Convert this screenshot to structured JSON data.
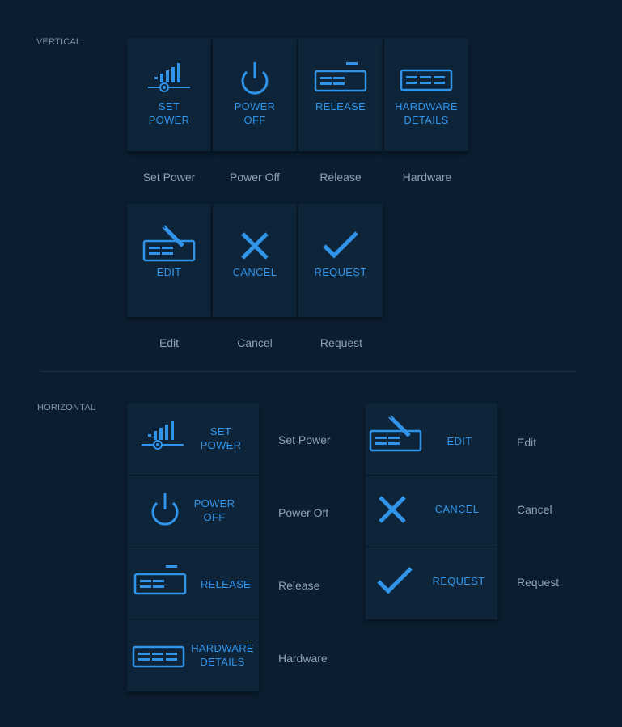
{
  "sections": {
    "vertical_label": "VERTICAL",
    "horizontal_label": "HORIZONTAL"
  },
  "colors": {
    "accent": "#2f94ea",
    "background": "#0b1e30",
    "tile": "#0e2438",
    "caption": "#8ea1b3"
  },
  "buttons": {
    "set_power": {
      "label": "SET\nPOWER",
      "caption": "Set Power",
      "icon": "signal-power-icon"
    },
    "power_off": {
      "label": "POWER\nOFF",
      "caption": "Power Off",
      "icon": "power-icon"
    },
    "release": {
      "label": "RELEASE",
      "caption": "Release",
      "icon": "release-icon"
    },
    "hardware": {
      "label": "HARDWARE\nDETAILS",
      "caption": "Hardware",
      "icon": "hardware-icon"
    },
    "edit": {
      "label": "EDIT",
      "caption": "Edit",
      "icon": "edit-icon"
    },
    "cancel": {
      "label": "CANCEL",
      "caption": "Cancel",
      "icon": "close-icon"
    },
    "request": {
      "label": "REQUEST",
      "caption": "Request",
      "icon": "checkmark-icon"
    }
  }
}
